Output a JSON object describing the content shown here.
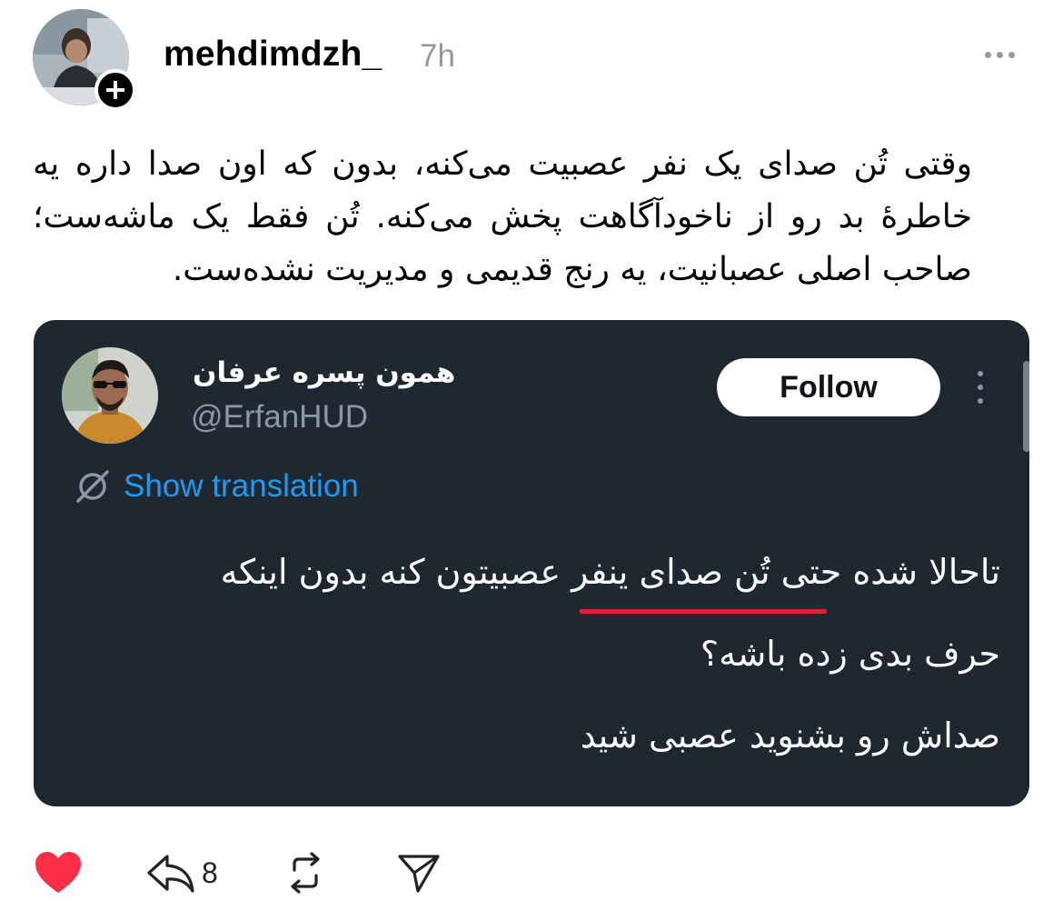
{
  "post": {
    "username": "mehdimdzh_",
    "time": "7h",
    "text": "وقتی تُن صدای یک نفر عصبیت می‌کنه، بدون که اون صدا داره یه خاطرهٔ بد رو از ناخودآگاهت پخش می‌کنه. تُن فقط یک ماشه‌ست؛ صاحب اصلی عصبانیت، یه رنج قدیمی و مدیریت نشده‌ست."
  },
  "quote": {
    "display_name": "همون پسره عرفان",
    "handle": "@ErfanHUD",
    "follow_label": "Follow",
    "translate_label": "Show translation",
    "lines": [
      "تاحالا شده حتی تُن صدای ینفر عصبیتون کنه بدون اینکه",
      "حرف بدی زده باشه؟",
      "صداش رو بشنوید عصبی شید"
    ],
    "accent_color": "#1d9bf0",
    "highlight_color": "#e0242f"
  },
  "actions": {
    "like_color": "#ff2d45",
    "reply_count": "8",
    "icons": [
      "heart-icon",
      "reply-icon",
      "repost-icon",
      "share-icon"
    ]
  }
}
